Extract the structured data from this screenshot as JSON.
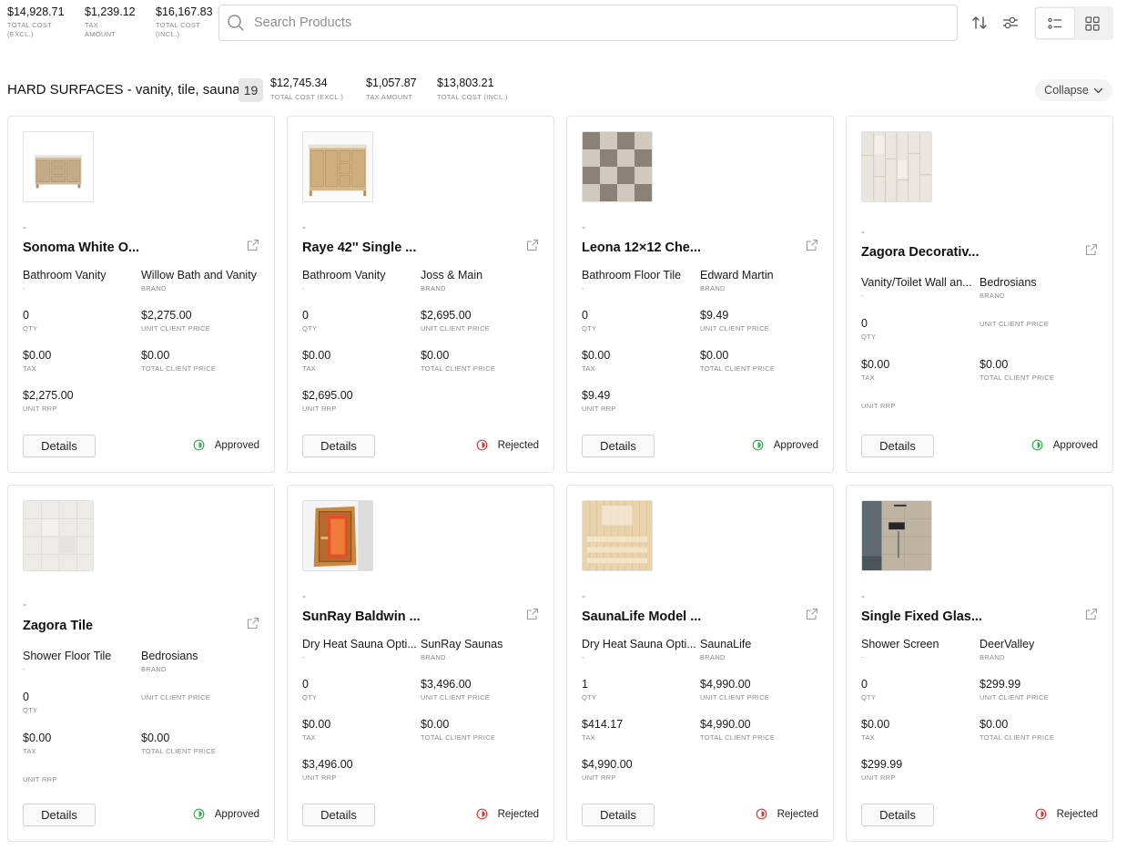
{
  "totals": [
    {
      "value": "$14,928.71",
      "label": "TOTAL COST (EXCL.)"
    },
    {
      "value": "$1,239.12",
      "label": "TAX AMOUNT"
    },
    {
      "value": "$16,167.83",
      "label": "TOTAL COST (INCL.)"
    }
  ],
  "search": {
    "placeholder": "Search Products",
    "value": ""
  },
  "toolbar": {
    "sort_icon": "sort-icon",
    "filter_icon": "filter-icon",
    "list_view_icon": "list-view-icon",
    "grid_view_icon": "grid-view-icon",
    "active_view": "list"
  },
  "group": {
    "title": "HARD SURFACES - vanity, tile, sauna",
    "count": "19",
    "stats": [
      {
        "value": "$12,745.34",
        "label": "TOTAL COST (EXCL.)"
      },
      {
        "value": "$1,057.87",
        "label": "TAX AMOUNT"
      },
      {
        "value": "$13,803.21",
        "label": "TOTAL COST (INCL.)"
      }
    ],
    "collapse_label": "Collapse"
  },
  "labels": {
    "brand": "BRAND",
    "qty": "QTY",
    "unit_client_price": "UNIT CLIENT PRICE",
    "tax": "TAX",
    "total_client_price": "TOTAL CLIENT PRICE",
    "unit_rrp": "UNIT RRP",
    "details": "Details",
    "dash": "-"
  },
  "colors": {
    "approved": "#2fb34a",
    "rejected": "#d63b3b",
    "border": "#e4e4e4"
  },
  "products": [
    {
      "title": "Sonoma White O...",
      "category": "Bathroom Vanity",
      "category_sub": "-",
      "brand": "Willow Bath and Vanity",
      "qty": "0",
      "unit_client_price": "$2,275.00",
      "tax": "$0.00",
      "total_client_price": "$0.00",
      "unit_rrp": "$2,275.00",
      "status": "Approved"
    },
    {
      "title": "Raye 42'' Single ...",
      "category": "Bathroom Vanity",
      "category_sub": "-",
      "brand": "Joss & Main",
      "qty": "0",
      "unit_client_price": "$2,695.00",
      "tax": "$0.00",
      "total_client_price": "$0.00",
      "unit_rrp": "$2,695.00",
      "status": "Rejected"
    },
    {
      "title": "Leona 12×12 Che...",
      "category": "Bathroom Floor Tile",
      "category_sub": "-",
      "brand": "Edward Martin",
      "qty": "0",
      "unit_client_price": "$9.49",
      "tax": "$0.00",
      "total_client_price": "$0.00",
      "unit_rrp": "$9.49",
      "status": "Approved"
    },
    {
      "title": "Zagora Decorativ...",
      "category": "Vanity/Toilet Wall an...",
      "category_sub": "-",
      "brand": "Bedrosians",
      "qty": "0",
      "unit_client_price": "",
      "tax": "$0.00",
      "total_client_price": "$0.00",
      "unit_rrp": "",
      "status": "Approved"
    },
    {
      "title": "Zagora Tile",
      "category": "Shower Floor Tile",
      "category_sub": "-",
      "brand": "Bedrosians",
      "qty": "0",
      "unit_client_price": "",
      "tax": "$0.00",
      "total_client_price": "$0.00",
      "unit_rrp": "",
      "status": "Approved"
    },
    {
      "title": "SunRay Baldwin ...",
      "category": "Dry Heat Sauna Opti...",
      "category_sub": "-",
      "brand": "SunRay Saunas",
      "qty": "0",
      "unit_client_price": "$3,496.00",
      "tax": "$0.00",
      "total_client_price": "$0.00",
      "unit_rrp": "$3,496.00",
      "status": "Rejected"
    },
    {
      "title": "SaunaLife Model ...",
      "category": "Dry Heat Sauna Opti...",
      "category_sub": "-",
      "brand": "SaunaLife",
      "qty": "1",
      "unit_client_price": "$4,990.00",
      "tax": "$414.17",
      "total_client_price": "$4,990.00",
      "unit_rrp": "$4,990.00",
      "status": "Rejected"
    },
    {
      "title": "Single Fixed Glas...",
      "category": "Shower Screen",
      "category_sub": "-",
      "brand": "DeerValley",
      "qty": "0",
      "unit_client_price": "$299.99",
      "tax": "$0.00",
      "total_client_price": "$0.00",
      "unit_rrp": "$299.99",
      "status": "Rejected"
    }
  ]
}
